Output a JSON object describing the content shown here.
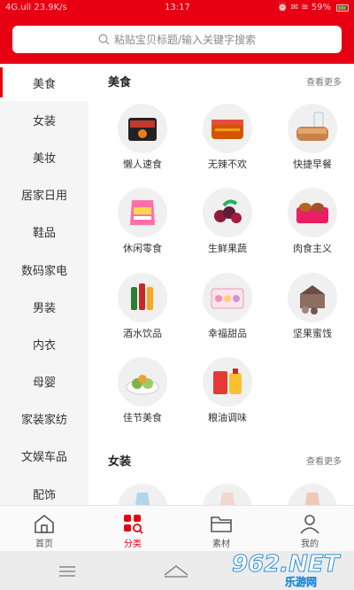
{
  "statusbar": {
    "left": "4G.ull 23.9K/s",
    "time": "13:17",
    "right": "⏰ ✉ ≋ 59%"
  },
  "search": {
    "placeholder": "粘贴宝贝标题/输入关键字搜索"
  },
  "sidebar": {
    "items": [
      {
        "label": "美食"
      },
      {
        "label": "女装"
      },
      {
        "label": "美妆"
      },
      {
        "label": "居家日用"
      },
      {
        "label": "鞋品"
      },
      {
        "label": "数码家电"
      },
      {
        "label": "男装"
      },
      {
        "label": "内衣"
      },
      {
        "label": "母婴"
      },
      {
        "label": "家装家纺"
      },
      {
        "label": "文娱车品"
      },
      {
        "label": "配饰"
      }
    ],
    "active_index": 0
  },
  "sections": [
    {
      "title": "美食",
      "more": "查看更多",
      "items": [
        {
          "label": "懒人速食",
          "icon": "instant-noodles-icon"
        },
        {
          "label": "无辣不欢",
          "icon": "spicy-jerky-icon"
        },
        {
          "label": "快捷早餐",
          "icon": "bread-milk-icon"
        },
        {
          "label": "休闲零食",
          "icon": "snack-bag-icon"
        },
        {
          "label": "生鲜果蔬",
          "icon": "fresh-fruit-icon"
        },
        {
          "label": "肉食主义",
          "icon": "meat-box-icon"
        },
        {
          "label": "酒水饮品",
          "icon": "drink-bottles-icon"
        },
        {
          "label": "幸福甜品",
          "icon": "dessert-box-icon"
        },
        {
          "label": "坚果蜜饯",
          "icon": "nuts-box-icon"
        },
        {
          "label": "佳节美食",
          "icon": "festival-food-icon"
        },
        {
          "label": "粮油调味",
          "icon": "rice-oil-icon"
        }
      ]
    },
    {
      "title": "女装",
      "more": "查看更多",
      "items": [
        {
          "label": "",
          "icon": "dress-icon"
        },
        {
          "label": "",
          "icon": "dress-icon"
        },
        {
          "label": "",
          "icon": "dress-icon"
        }
      ]
    }
  ],
  "tabbar": {
    "tabs": [
      {
        "label": "首页",
        "icon": "home-icon"
      },
      {
        "label": "分类",
        "icon": "category-icon",
        "active": true
      },
      {
        "label": "素材",
        "icon": "folder-icon"
      },
      {
        "label": "我的",
        "icon": "user-icon"
      }
    ]
  },
  "watermark": {
    "main": "962.NET",
    "sub": "乐游网"
  },
  "colors": {
    "brand": "#e60012",
    "sidebar_bg": "#f5f5f5"
  }
}
